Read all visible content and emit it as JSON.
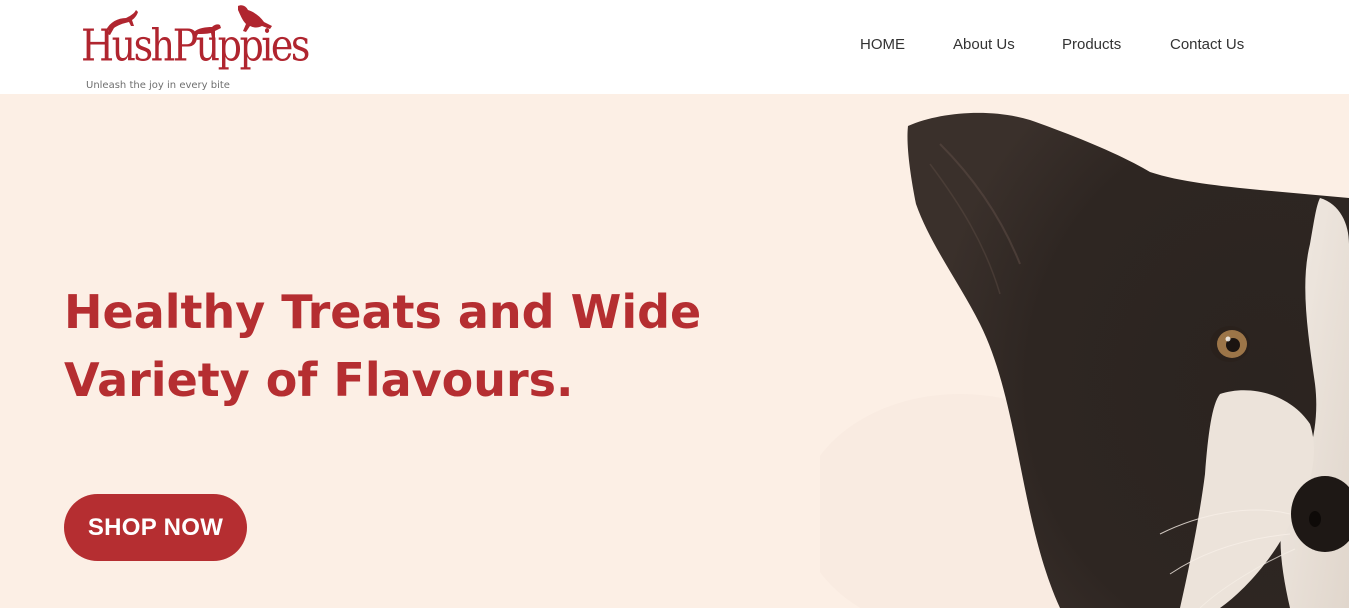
{
  "brand": {
    "name": "HushPuppies",
    "tagline": "Unleash the joy in every bite",
    "color": "#b0252f"
  },
  "nav": {
    "items": [
      "HOME",
      "About Us",
      "Products",
      "Contact Us"
    ]
  },
  "hero": {
    "headline_lines": [
      "Healthy Treats and Wide",
      "Variety of Flavours."
    ],
    "cta_label": "SHOP NOW",
    "background": "#fcefe5",
    "accent": "#b52e31",
    "image": "border-collie-dog-photo"
  }
}
